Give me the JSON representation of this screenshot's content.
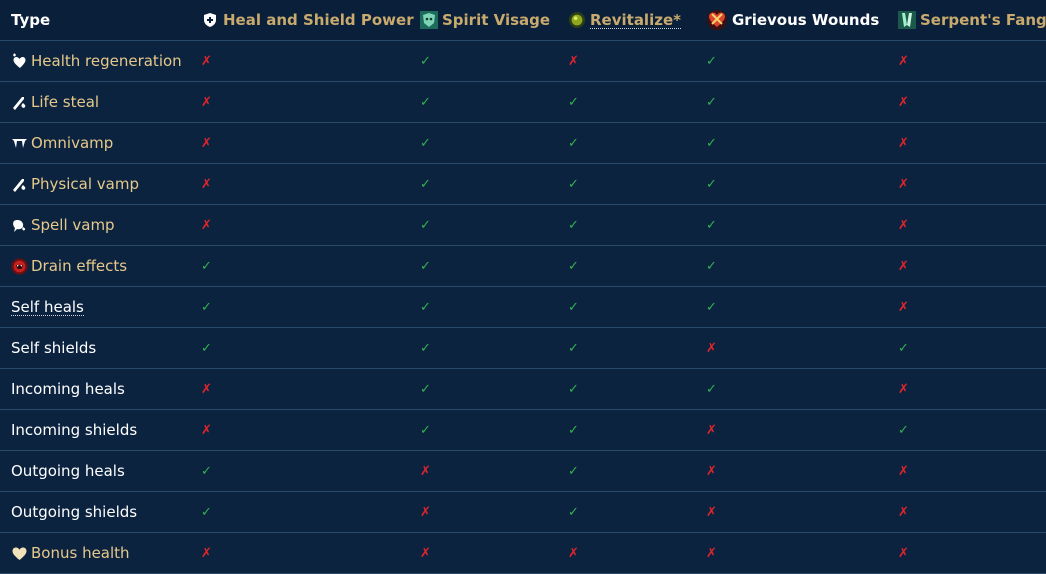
{
  "colors": {
    "yes": "#2fb34f",
    "no": "#e2242b",
    "background": "#0c2340",
    "gold": "#c8aa6e"
  },
  "marks": {
    "yes": "✓",
    "no": "✗"
  },
  "header": {
    "type": "Type",
    "columns": [
      {
        "label": "Heal and Shield Power",
        "icon": "shield-heal-icon"
      },
      {
        "label": "Spirit Visage",
        "icon": "spirit-visage-icon"
      },
      {
        "label": "Revitalize*",
        "icon": "revitalize-icon"
      },
      {
        "label": "Grievous Wounds",
        "icon": "grievous-wounds-icon"
      },
      {
        "label": "Serpent's Fang",
        "icon": "serpents-fang-icon"
      }
    ]
  },
  "rows": [
    {
      "type": "Health regeneration",
      "icon": "health-regen-icon",
      "values": [
        false,
        true,
        false,
        true,
        false
      ]
    },
    {
      "type": "Life steal",
      "icon": "life-steal-icon",
      "values": [
        false,
        true,
        true,
        true,
        false
      ]
    },
    {
      "type": "Omnivamp",
      "icon": "omnivamp-icon",
      "values": [
        false,
        true,
        true,
        true,
        false
      ]
    },
    {
      "type": "Physical vamp",
      "icon": "physical-vamp-icon",
      "values": [
        false,
        true,
        true,
        true,
        false
      ]
    },
    {
      "type": "Spell vamp",
      "icon": "spell-vamp-icon",
      "values": [
        false,
        true,
        true,
        true,
        false
      ]
    },
    {
      "type": "Drain effects",
      "icon": "drain-effects-icon",
      "values": [
        true,
        true,
        true,
        true,
        false
      ]
    },
    {
      "type": "Self heals",
      "icon": "",
      "values": [
        true,
        true,
        true,
        true,
        false
      ]
    },
    {
      "type": "Self shields",
      "icon": "",
      "values": [
        true,
        true,
        true,
        false,
        true
      ]
    },
    {
      "type": "Incoming heals",
      "icon": "",
      "values": [
        false,
        true,
        true,
        true,
        false
      ]
    },
    {
      "type": "Incoming shields",
      "icon": "",
      "values": [
        false,
        true,
        true,
        false,
        true
      ]
    },
    {
      "type": "Outgoing heals",
      "icon": "",
      "values": [
        true,
        false,
        true,
        false,
        false
      ]
    },
    {
      "type": "Outgoing shields",
      "icon": "",
      "values": [
        true,
        false,
        true,
        false,
        false
      ]
    },
    {
      "type": "Bonus health",
      "icon": "bonus-health-icon",
      "values": [
        false,
        false,
        false,
        false,
        false
      ]
    }
  ]
}
